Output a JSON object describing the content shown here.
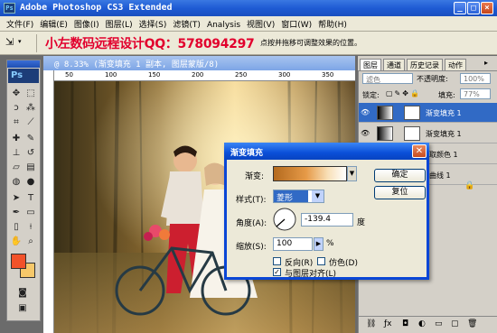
{
  "app": {
    "title": "Adobe Photoshop CS3 Extended",
    "icon": "Ps",
    "window_buttons": [
      "_",
      "□",
      "×"
    ]
  },
  "menu": [
    "文件(F)",
    "编辑(E)",
    "图像(I)",
    "图层(L)",
    "选择(S)",
    "滤镜(T)",
    "Analysis",
    "视图(V)",
    "窗口(W)",
    "帮助(H)"
  ],
  "options": {
    "tool_glyph": "⇲",
    "promo": "小左数码远程设计QQ：578094297",
    "hint": "点按并拖移可调整效果的位置。"
  },
  "panel_tabs": [
    "图层",
    "通道",
    "历史记录",
    "动作"
  ],
  "document": {
    "title": "@ 8.33% (渐变填充 1 副本, 图层蒙版/8)",
    "ruler_labels": [
      "50",
      "100",
      "150",
      "200",
      "250",
      "300",
      "350"
    ]
  },
  "layers_panel": {
    "blend_mode": "滤色",
    "opacity_label": "不透明度:",
    "opacity_value": "100%",
    "lock_label": "锁定:",
    "fill_label": "填充:",
    "fill_value": "77%",
    "layers": [
      {
        "name": "渐变填充 1",
        "selected": true
      },
      {
        "name": "渐变填充 1",
        "selected": false
      },
      {
        "name": "取颜色 1",
        "selected": false
      },
      {
        "name": "曲线 1",
        "selected": false
      }
    ]
  },
  "toolbox": {
    "label": "Ps"
  },
  "dialog": {
    "title": "渐变填充",
    "gradient_label": "渐变:",
    "style_label": "样式(T):",
    "style_value": "菱形",
    "angle_label": "角度(A):",
    "angle_value": "-139.4",
    "angle_unit": "度",
    "scale_label": "缩放(S):",
    "scale_value": "100",
    "scale_unit": "%",
    "reverse_label": "反向(R)",
    "dither_label": "仿色(D)",
    "align_label": "与图层对齐(L)",
    "reverse_checked": false,
    "dither_checked": false,
    "align_checked": true,
    "ok_label": "确定",
    "reset_label": "复位"
  },
  "colors": {
    "foreground": "#f2522a",
    "background": "#f6c86a",
    "accent": "#0a4fd8"
  }
}
